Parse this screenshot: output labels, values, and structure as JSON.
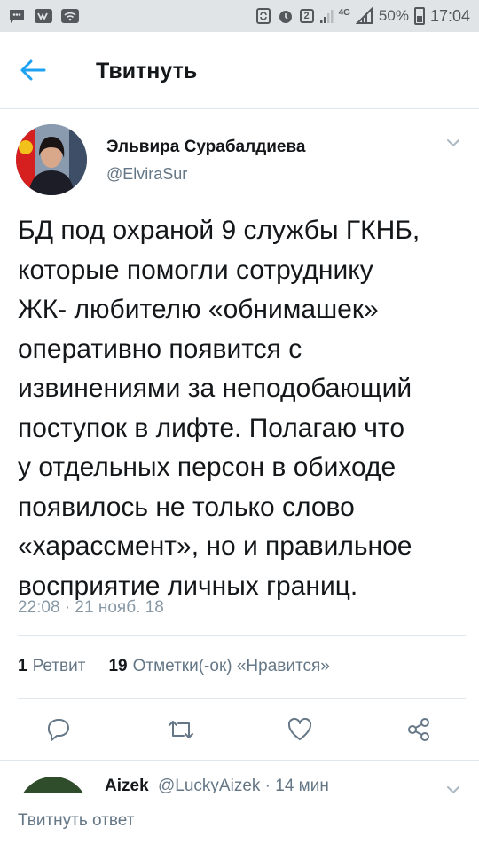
{
  "status_bar": {
    "battery": "50%",
    "time": "17:04",
    "network": "4G"
  },
  "header": {
    "title": "Твитнуть",
    "icons": [
      "arrow-left-icon"
    ]
  },
  "tweet": {
    "author_name": "Эльвира Сурабалдиева",
    "author_handle": "@ElviraSur",
    "text": "БД под охраной 9 службы ГКНБ,\nкоторые помогли сотруднику\nЖК- любителю «обнимашек»\nоперативно появится с\nизвинениями за неподобающий\nпоступок в лифте. Полагаю что\nу отдельных персон в обиходе\nпоявилось не только слово\n«харассмент», но и правильное\nвосприятие личных границ.",
    "timestamp": "22:08 · 21 нояб. 18",
    "retweets_count": "1",
    "retweets_label": "Ретвит",
    "likes_count": "19",
    "likes_label": "Отметки(-ок) «Нравится»"
  },
  "actions": [
    "reply-icon",
    "retweet-icon",
    "like-icon",
    "share-icon"
  ],
  "reply_preview": {
    "name": "Aizek",
    "handle": "@LuckyAizek · 14 мин"
  },
  "compose": {
    "placeholder": "Твитнуть ответ"
  },
  "colors": {
    "accent": "#1da1f2",
    "muted": "#657786",
    "status_bar_bg": "#e1e4e7"
  }
}
